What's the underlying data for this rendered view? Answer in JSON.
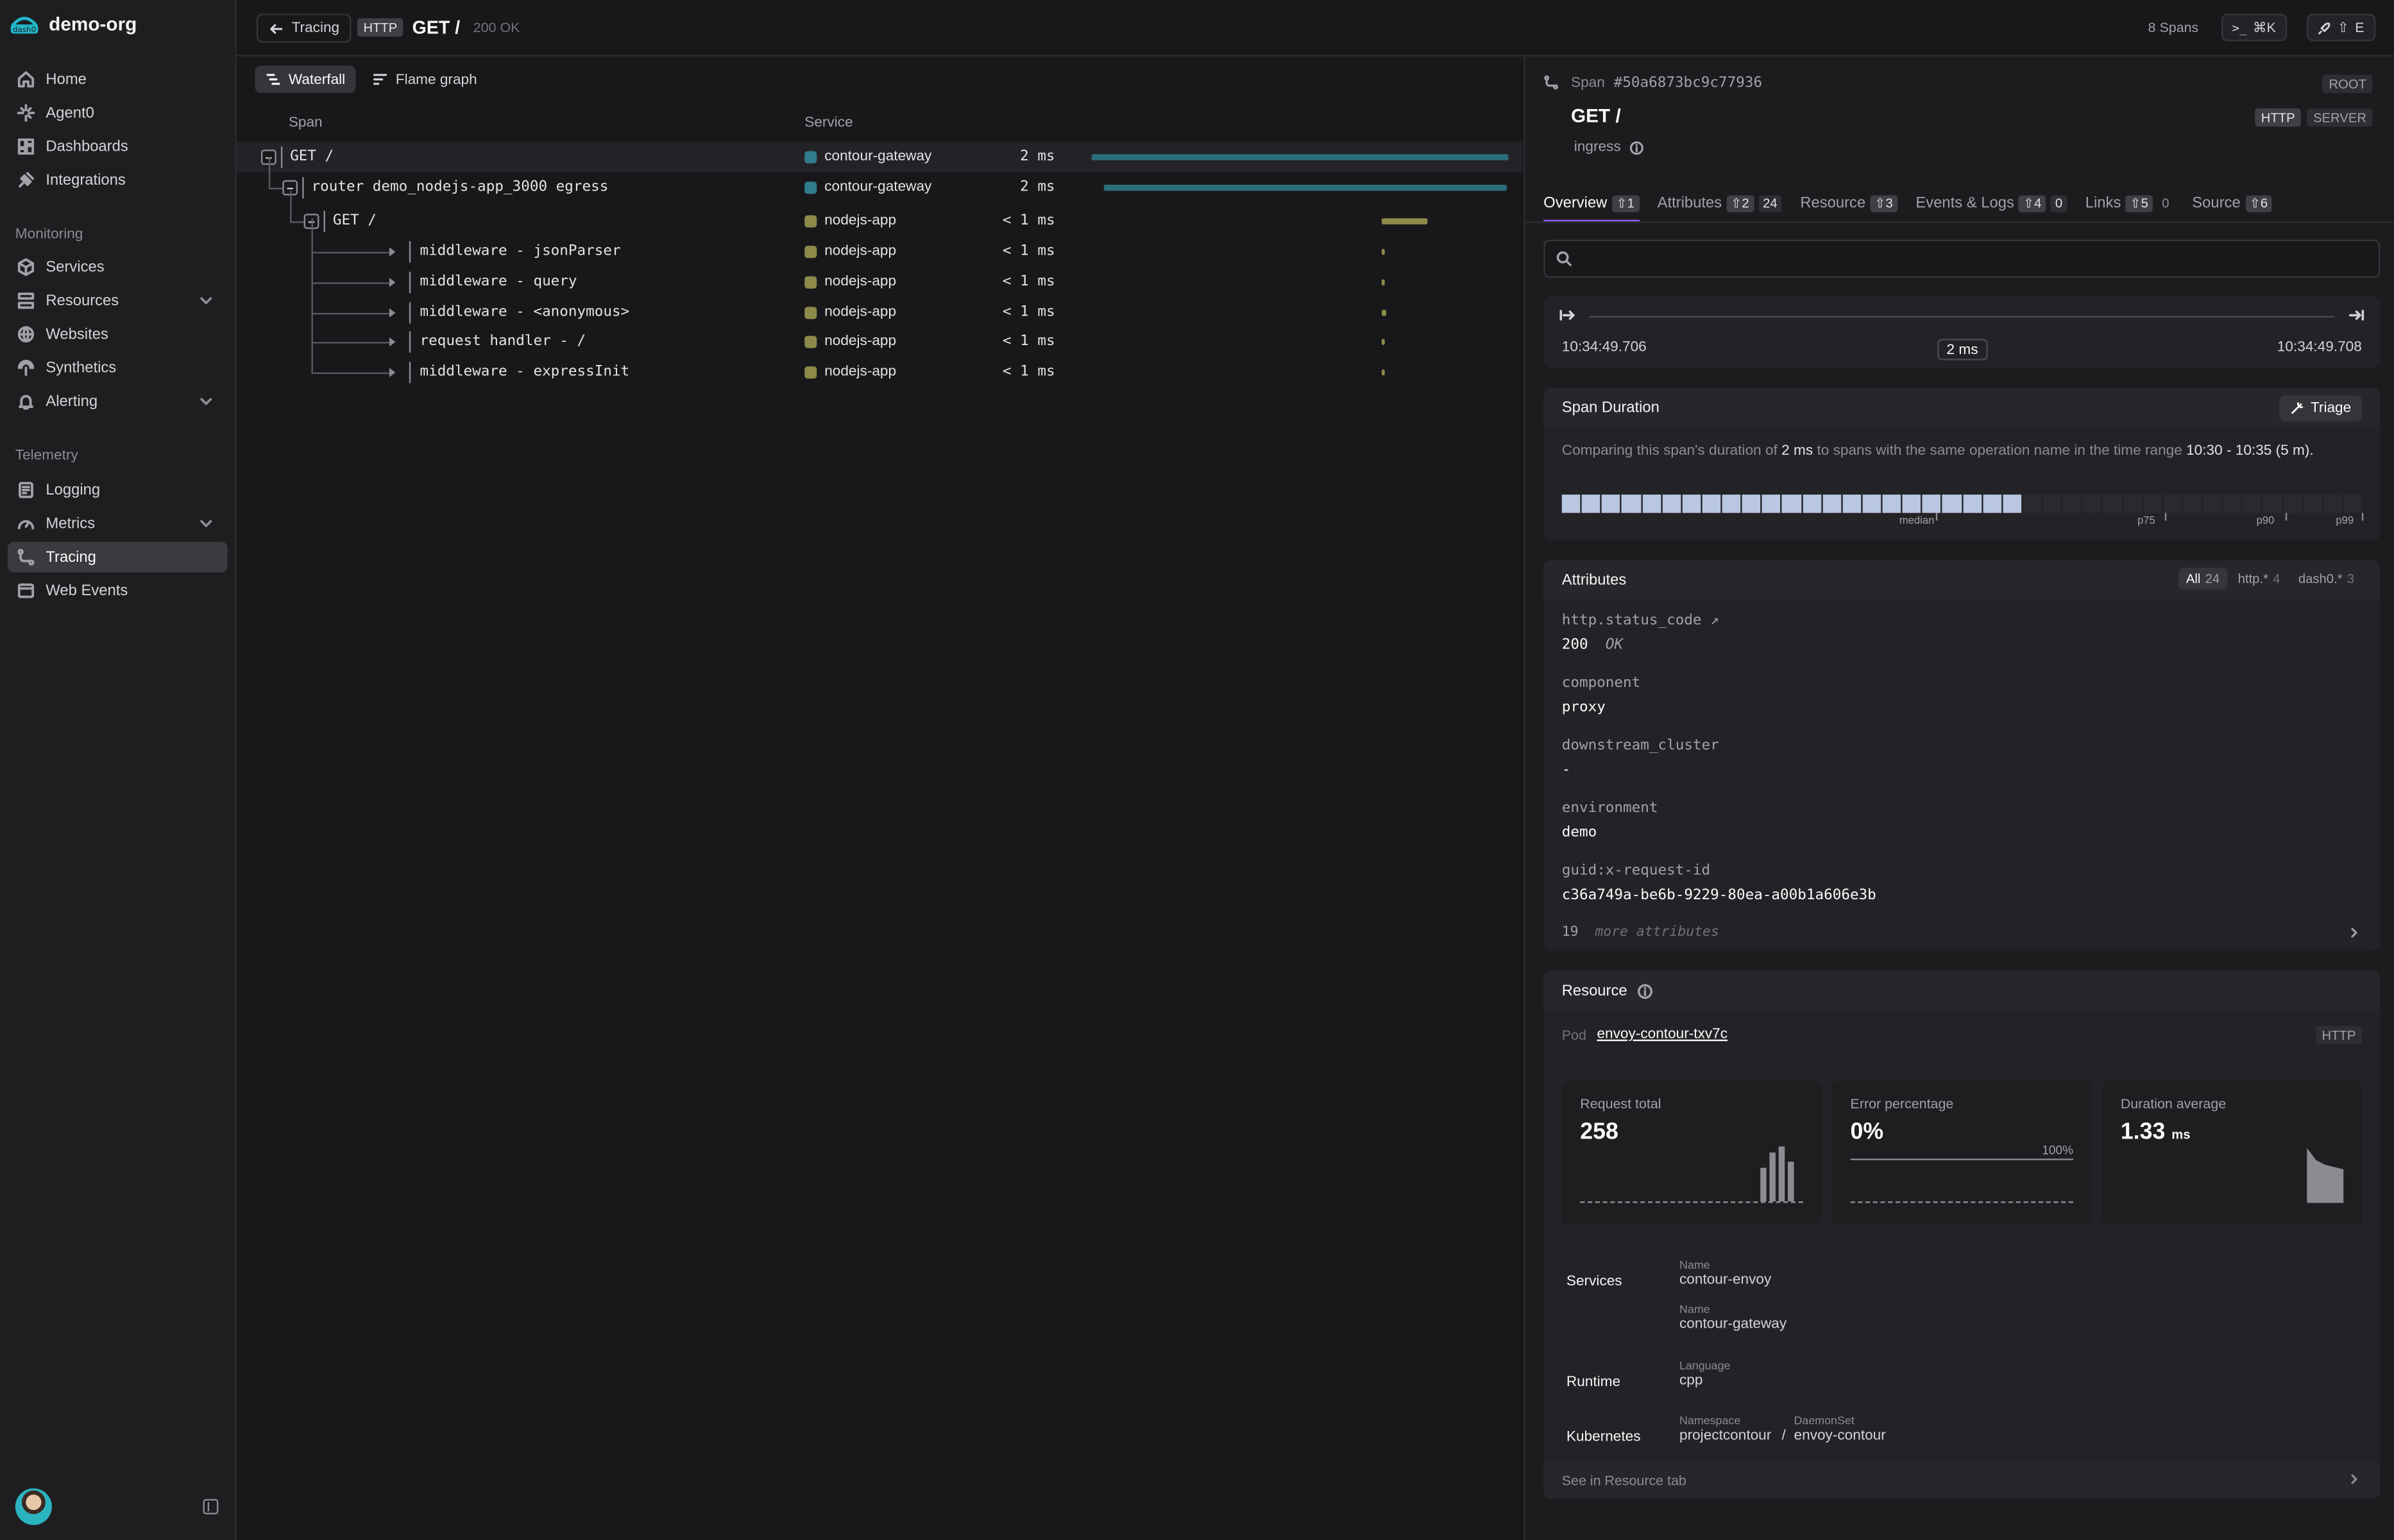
{
  "org": {
    "name": "demo-org",
    "logo_text": "dash0"
  },
  "nav": {
    "top": [
      {
        "label": "Home",
        "icon": "home-icon"
      },
      {
        "label": "Agent0",
        "icon": "sparkles-icon"
      },
      {
        "label": "Dashboards",
        "icon": "dashboard-icon"
      },
      {
        "label": "Integrations",
        "icon": "plug-icon"
      }
    ],
    "monitoring_title": "Monitoring",
    "monitoring": [
      {
        "label": "Services",
        "icon": "cube-icon"
      },
      {
        "label": "Resources",
        "icon": "layers-icon",
        "expandable": true
      },
      {
        "label": "Websites",
        "icon": "globe-icon"
      },
      {
        "label": "Synthetics",
        "icon": "synthetics-icon"
      },
      {
        "label": "Alerting",
        "icon": "bell-icon",
        "expandable": true
      }
    ],
    "telemetry_title": "Telemetry",
    "telemetry": [
      {
        "label": "Logging",
        "icon": "log-icon"
      },
      {
        "label": "Metrics",
        "icon": "gauge-icon",
        "expandable": true
      },
      {
        "label": "Tracing",
        "icon": "trace-icon",
        "active": true
      },
      {
        "label": "Web Events",
        "icon": "browser-icon"
      }
    ]
  },
  "topbar": {
    "back_label": "Tracing",
    "protocol": "HTTP",
    "title": "GET /",
    "status": "200 OK",
    "spans_count": "8 Spans",
    "shortcut1": "⌘K",
    "shortcut2": "E"
  },
  "waterfall": {
    "tabs": [
      {
        "label": "Waterfall",
        "active": true
      },
      {
        "label": "Flame graph"
      }
    ],
    "col_span": "Span",
    "col_service": "Service",
    "rows": [
      {
        "name": "GET /",
        "service": "contour-gateway",
        "duration": "2 ms",
        "color": "#2f7d8c"
      },
      {
        "name": "router demo_nodejs-app_3000 egress",
        "service": "contour-gateway",
        "duration": "2 ms",
        "color": "#2f7d8c"
      },
      {
        "name": "GET /",
        "service": "nodejs-app",
        "duration": "< 1 ms",
        "color": "#8d8a4a"
      },
      {
        "name": "middleware - jsonParser",
        "service": "nodejs-app",
        "duration": "< 1 ms",
        "color": "#8d8a4a"
      },
      {
        "name": "middleware - query",
        "service": "nodejs-app",
        "duration": "< 1 ms",
        "color": "#8d8a4a"
      },
      {
        "name": "middleware - <anonymous>",
        "service": "nodejs-app",
        "duration": "< 1 ms",
        "color": "#8d8a4a"
      },
      {
        "name": "request handler - /",
        "service": "nodejs-app",
        "duration": "< 1 ms",
        "color": "#8d8a4a"
      },
      {
        "name": "middleware - expressInit",
        "service": "nodejs-app",
        "duration": "< 1 ms",
        "color": "#8d8a4a"
      }
    ]
  },
  "panel": {
    "span_label": "Span",
    "span_id": "#50a6873bc9c77936",
    "root_badge": "ROOT",
    "title": "GET /",
    "badges": [
      "HTTP",
      "SERVER"
    ],
    "kind": "ingress",
    "tabs": [
      {
        "label": "Overview",
        "count": "1",
        "active": true
      },
      {
        "label": "Attributes",
        "count": "2",
        "extra": "24"
      },
      {
        "label": "Resource",
        "count": "3"
      },
      {
        "label": "Events & Logs",
        "count": "4",
        "extra": "0"
      },
      {
        "label": "Links",
        "count": "5",
        "extra": "0"
      },
      {
        "label": "Source",
        "count": "6"
      }
    ],
    "timeline": {
      "start": "10:34:49.706",
      "duration": "2 ms",
      "end": "10:34:49.708"
    },
    "span_duration": {
      "title": "Span Duration",
      "triage_label": "Triage",
      "desc_a": "Comparing this span's duration of ",
      "desc_dur": "2 ms",
      "desc_b": " to spans with the same operation name in the time range ",
      "desc_range": "10:30 - 10:35 (5 m).",
      "buckets_total": 40,
      "buckets_filled": 23,
      "labels": {
        "median": "median",
        "p75": "p75",
        "p90": "p90",
        "p99": "p99"
      }
    },
    "attributes": {
      "title": "Attributes",
      "filters": [
        {
          "label": "All",
          "count": "24",
          "active": true
        },
        {
          "label": "http.*",
          "count": "4"
        },
        {
          "label": "dash0.*",
          "count": "3"
        }
      ],
      "items": [
        {
          "key": "http.status_code",
          "value": "200",
          "note": "OK"
        },
        {
          "key": "component",
          "value": "proxy"
        },
        {
          "key": "downstream_cluster",
          "value": "-"
        },
        {
          "key": "environment",
          "value": "demo"
        },
        {
          "key": "guid:x-request-id",
          "value": "c36a749a-be6b-9229-80ea-a00b1a606e3b"
        }
      ],
      "more_count": "19",
      "more_label": "more attributes"
    },
    "resource": {
      "title": "Resource",
      "pod_label": "Pod",
      "pod_name": "envoy-contour-txv7c",
      "pod_badge": "HTTP",
      "metrics": [
        {
          "label": "Request total",
          "value": "258",
          "unit": ""
        },
        {
          "label": "Error percentage",
          "value": "0%",
          "unit": "",
          "ref": "100%"
        },
        {
          "label": "Duration average",
          "value": "1.33",
          "unit": "ms"
        }
      ],
      "services_label": "Services",
      "services": [
        {
          "key": "Name",
          "value": "contour-envoy"
        },
        {
          "key": "Name",
          "value": "contour-gateway"
        }
      ],
      "runtime_label": "Runtime",
      "runtime": {
        "key": "Language",
        "value": "cpp"
      },
      "kubernetes_label": "Kubernetes",
      "kubernetes": {
        "ns_key": "Namespace",
        "ns_value": "projectcontour",
        "sep": "/",
        "ds_key": "DaemonSet",
        "ds_value": "envoy-contour"
      },
      "see_more": "See in Resource tab"
    }
  }
}
